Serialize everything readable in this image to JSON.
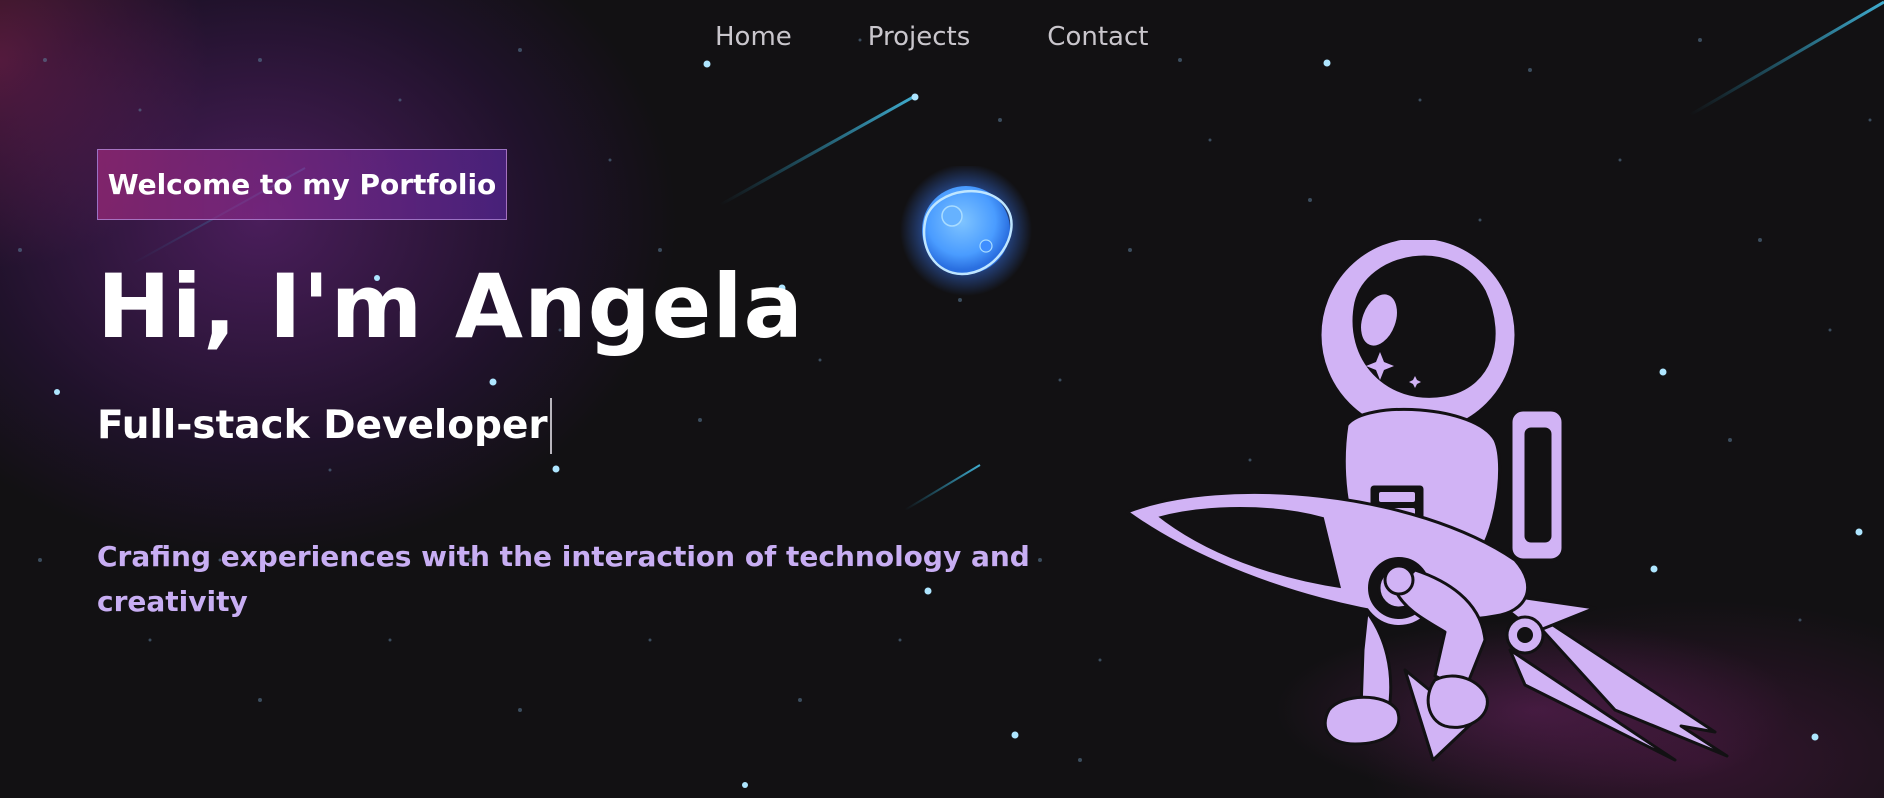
{
  "nav": {
    "items": [
      {
        "label": "Home"
      },
      {
        "label": "Projects"
      },
      {
        "label": "Contact"
      }
    ]
  },
  "hero": {
    "badge": "Welcome to my Portfolio",
    "title": "Hi, I'm Angela",
    "role": "Full-stack Developer",
    "tagline": "Crafing experiences with the interaction of technology and creativity"
  },
  "icons": {
    "planet": "planet-icon",
    "astronaut": "astronaut-rocket-illustration"
  },
  "colors": {
    "background": "#121113",
    "accent_lavender": "#c8aef3",
    "astronaut": "#d1b3f5",
    "planet": "#4a9cff",
    "star": "#aee6ff",
    "nav_text": "#c9c6cc"
  }
}
